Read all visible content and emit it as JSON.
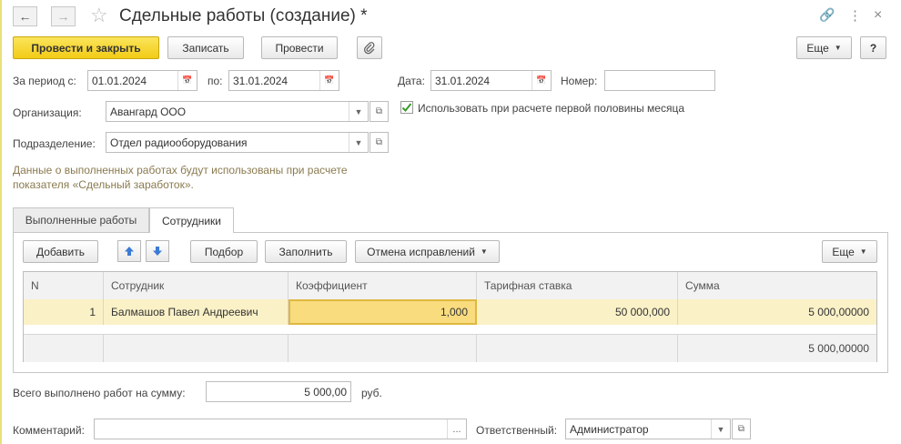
{
  "header": {
    "title": "Сдельные работы (создание) *"
  },
  "toolbar": {
    "post_close": "Провести и закрыть",
    "save": "Записать",
    "post": "Провести",
    "more": "Еще",
    "help": "?"
  },
  "form": {
    "period_from_label": "За период с:",
    "period_from": "01.01.2024",
    "period_to_label": "по:",
    "period_to": "31.01.2024",
    "date_label": "Дата:",
    "date": "31.01.2024",
    "number_label": "Номер:",
    "number": "",
    "org_label": "Организация:",
    "org": "Авангард ООО",
    "dept_label": "Подразделение:",
    "dept": "Отдел радиооборудования",
    "first_half_checkbox": "Использовать при расчете первой половины месяца",
    "note_line1": "Данные о выполненных работах будут использованы при расчете",
    "note_line2": "показателя «Сдельный заработок»."
  },
  "tabs": [
    {
      "label": "Выполненные работы"
    },
    {
      "label": "Сотрудники"
    }
  ],
  "grid_toolbar": {
    "add": "Добавить",
    "select": "Подбор",
    "fill": "Заполнить",
    "cancel_corrections": "Отмена исправлений",
    "more": "Еще"
  },
  "grid": {
    "columns": [
      "N",
      "Сотрудник",
      "Коэффициент",
      "Тарифная ставка",
      "Сумма"
    ],
    "rows": [
      {
        "n": "1",
        "employee": "Балмашов Павел Андреевич",
        "coef": "1,000",
        "rate": "50 000,000",
        "sum": "5 000,00000"
      }
    ],
    "footer_sum": "5 000,00000"
  },
  "totals": {
    "label": "Всего выполнено работ на сумму:",
    "value": "5 000,00",
    "currency": "руб."
  },
  "bottom": {
    "comment_label": "Комментарий:",
    "comment": "",
    "responsible_label": "Ответственный:",
    "responsible": "Администратор"
  },
  "colors": {
    "primary_button": "#f2cb16",
    "selected_row": "#fbf1c7",
    "note_text": "#8a7a4f",
    "checkbox_mark": "#3a9a2a",
    "arrow_icon": "#3a7bd5"
  }
}
